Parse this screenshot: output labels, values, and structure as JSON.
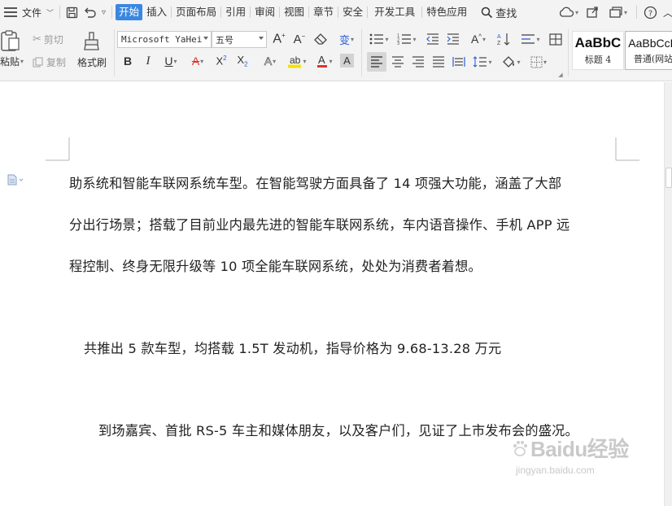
{
  "menu": {
    "file_label": "文件",
    "tabs": [
      {
        "label": "开始",
        "active": true
      },
      {
        "label": "插入"
      },
      {
        "label": "页面布局"
      },
      {
        "label": "引用"
      },
      {
        "label": "审阅"
      },
      {
        "label": "视图"
      },
      {
        "label": "章节"
      },
      {
        "label": "安全"
      },
      {
        "label": "开发工具"
      },
      {
        "label": "特色应用"
      }
    ],
    "find_label": "查找"
  },
  "ribbon": {
    "paste_label": "粘贴",
    "cut_label": "剪切",
    "copy_label": "复制",
    "format_painter_label": "格式刷",
    "font_name": "Microsoft YaHei",
    "font_size": "五号",
    "styles": [
      {
        "sample": "AaBbC",
        "name": "标题 4"
      },
      {
        "sample": "AaBbCcD",
        "name": "普通(网站"
      }
    ]
  },
  "document": {
    "paragraphs": [
      "助系统和智能车联网系统车型。在智能驾驶方面具备了 14 项强大功能，涵盖了大部",
      "分出行场景；搭载了目前业内最先进的智能车联网系统，车内语音操作、手机 APP 远",
      "程控制、终身无限升级等 10 项全能车联网系统，处处为消费者着想。",
      "共推出 5 款车型，均搭载 1.5T 发动机，指导价格为 9.68-13.28 万元",
      "到场嘉宾、首批 RS-5 车主和媒体朋友，以及客户们，见证了上市发布会的盛况。"
    ]
  },
  "watermark": {
    "main": "Baidu经验",
    "sub": "jingyan.baidu.com"
  },
  "colors": {
    "accent": "#3b87e0",
    "font_color_red": "#e0322b",
    "font_color_blue": "#2b5fd9",
    "highlight_yellow": "#f6e100"
  }
}
